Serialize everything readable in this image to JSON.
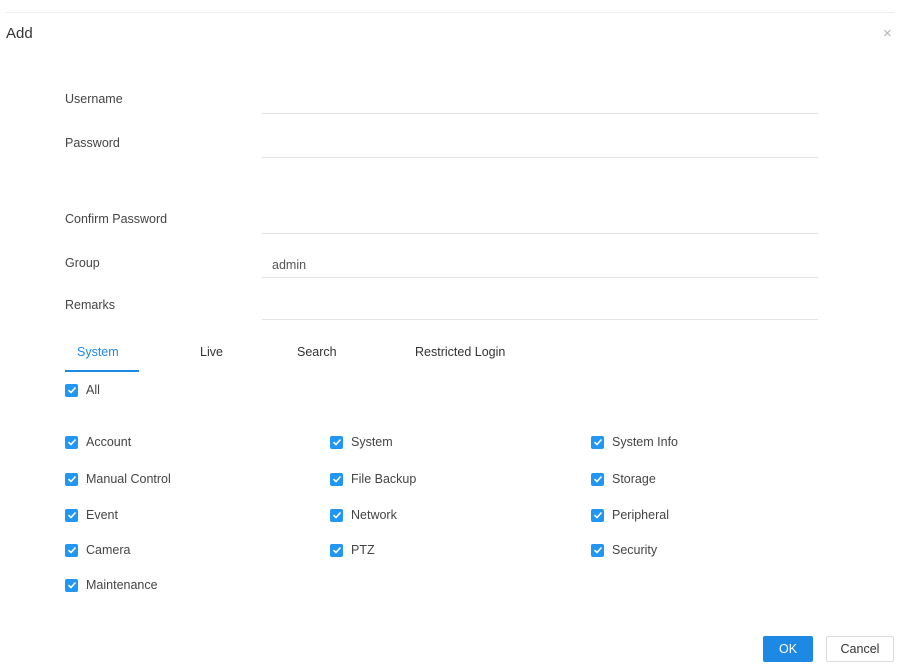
{
  "dialog": {
    "title": "Add",
    "close_icon": "×"
  },
  "form": {
    "username_label": "Username",
    "password_label": "Password",
    "confirm_password_label": "Confirm Password",
    "group_label": "Group",
    "group_value": "admin",
    "remarks_label": "Remarks"
  },
  "tabs": [
    {
      "label": "System",
      "active": true
    },
    {
      "label": "Live",
      "active": false
    },
    {
      "label": "Search",
      "active": false
    },
    {
      "label": "Restricted Login",
      "active": false
    }
  ],
  "permissions": {
    "all_label": "All",
    "items": [
      "Account",
      "System",
      "System Info",
      "Manual Control",
      "File Backup",
      "Storage",
      "Event",
      "Network",
      "Peripheral",
      "Camera",
      "PTZ",
      "Security",
      "Maintenance"
    ]
  },
  "buttons": {
    "ok": "OK",
    "cancel": "Cancel"
  },
  "colors": {
    "accent": "#1e88e5",
    "checkbox": "#2196f3"
  }
}
